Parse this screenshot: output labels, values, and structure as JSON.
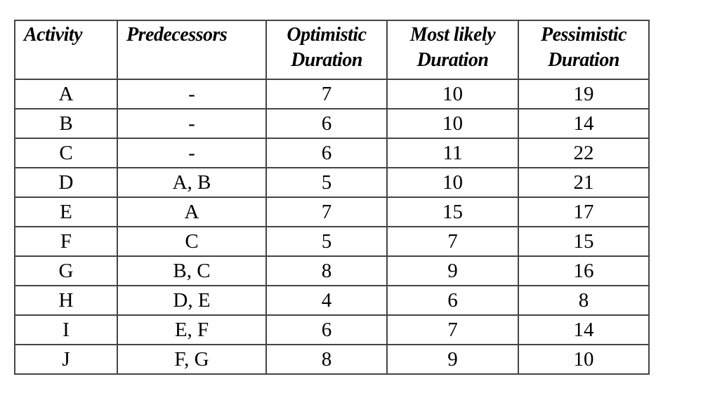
{
  "table": {
    "headers": [
      [
        "Activity",
        ""
      ],
      [
        "Predecessors",
        ""
      ],
      [
        "Optimistic",
        "Duration"
      ],
      [
        "Most likely",
        "Duration"
      ],
      [
        "Pessimistic",
        "Duration"
      ]
    ],
    "rows": [
      [
        "A",
        "-",
        "7",
        "10",
        "19"
      ],
      [
        "B",
        "-",
        "6",
        "10",
        "14"
      ],
      [
        "C",
        "-",
        "6",
        "11",
        "22"
      ],
      [
        "D",
        "A, B",
        "5",
        "10",
        "21"
      ],
      [
        "E",
        "A",
        "7",
        "15",
        "17"
      ],
      [
        "F",
        "C",
        "5",
        "7",
        "15"
      ],
      [
        "G",
        "B, C",
        "8",
        "9",
        "16"
      ],
      [
        "H",
        "D, E",
        "4",
        "6",
        "8"
      ],
      [
        "I",
        "E, F",
        "6",
        "7",
        "14"
      ],
      [
        "J",
        "F, G",
        "8",
        "9",
        "10"
      ]
    ]
  }
}
